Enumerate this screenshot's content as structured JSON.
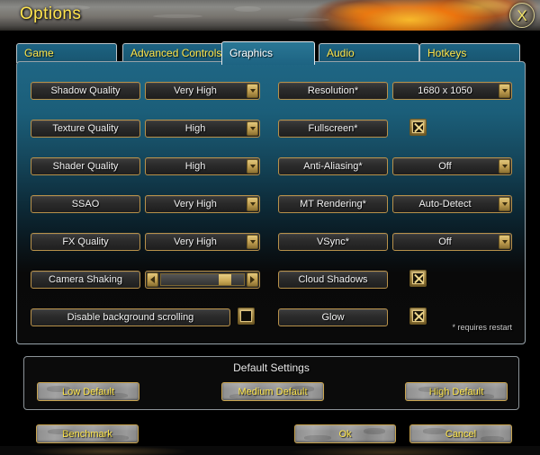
{
  "window": {
    "title": "Options",
    "close_label": "X"
  },
  "tabs": [
    {
      "label": "Game",
      "active": false
    },
    {
      "label": "Advanced Controls",
      "active": false
    },
    {
      "label": "Graphics",
      "active": true
    },
    {
      "label": "Audio",
      "active": false
    },
    {
      "label": "Hotkeys",
      "active": false
    }
  ],
  "graphics": {
    "left_column": [
      {
        "label": "Shadow Quality",
        "type": "dropdown",
        "value": "Very High"
      },
      {
        "label": "Texture Quality",
        "type": "dropdown",
        "value": "High"
      },
      {
        "label": "Shader Quality",
        "type": "dropdown",
        "value": "High"
      },
      {
        "label": "SSAO",
        "type": "dropdown",
        "value": "Very High"
      },
      {
        "label": "FX Quality",
        "type": "dropdown",
        "value": "Very High"
      },
      {
        "label": "Camera Shaking",
        "type": "slider",
        "value": 85
      },
      {
        "label": "Disable background scrolling",
        "type": "checkbox",
        "checked": false
      }
    ],
    "right_column": [
      {
        "label": "Resolution*",
        "type": "dropdown",
        "value": "1680 x 1050"
      },
      {
        "label": "Fullscreen*",
        "type": "checkbox",
        "checked": true
      },
      {
        "label": "Anti-Aliasing*",
        "type": "dropdown",
        "value": "Off"
      },
      {
        "label": "MT Rendering*",
        "type": "dropdown",
        "value": "Auto-Detect"
      },
      {
        "label": "VSync*",
        "type": "dropdown",
        "value": "Off"
      },
      {
        "label": "Cloud Shadows",
        "type": "checkbox",
        "checked": true
      },
      {
        "label": "Glow",
        "type": "checkbox",
        "checked": true
      }
    ],
    "restart_note": "* requires restart"
  },
  "defaults": {
    "title": "Default Settings",
    "buttons": [
      {
        "label": "Low Default"
      },
      {
        "label": "Medium Default"
      },
      {
        "label": "High Default"
      }
    ]
  },
  "footer": {
    "benchmark_label": "Benchmark",
    "ok_label": "Ok",
    "cancel_label": "Cancel"
  },
  "colors": {
    "gold_border": "#b8914a",
    "tab_text": "#ffe64a",
    "panel_blue": "#1f6684",
    "button_text": "#ffe64a"
  }
}
